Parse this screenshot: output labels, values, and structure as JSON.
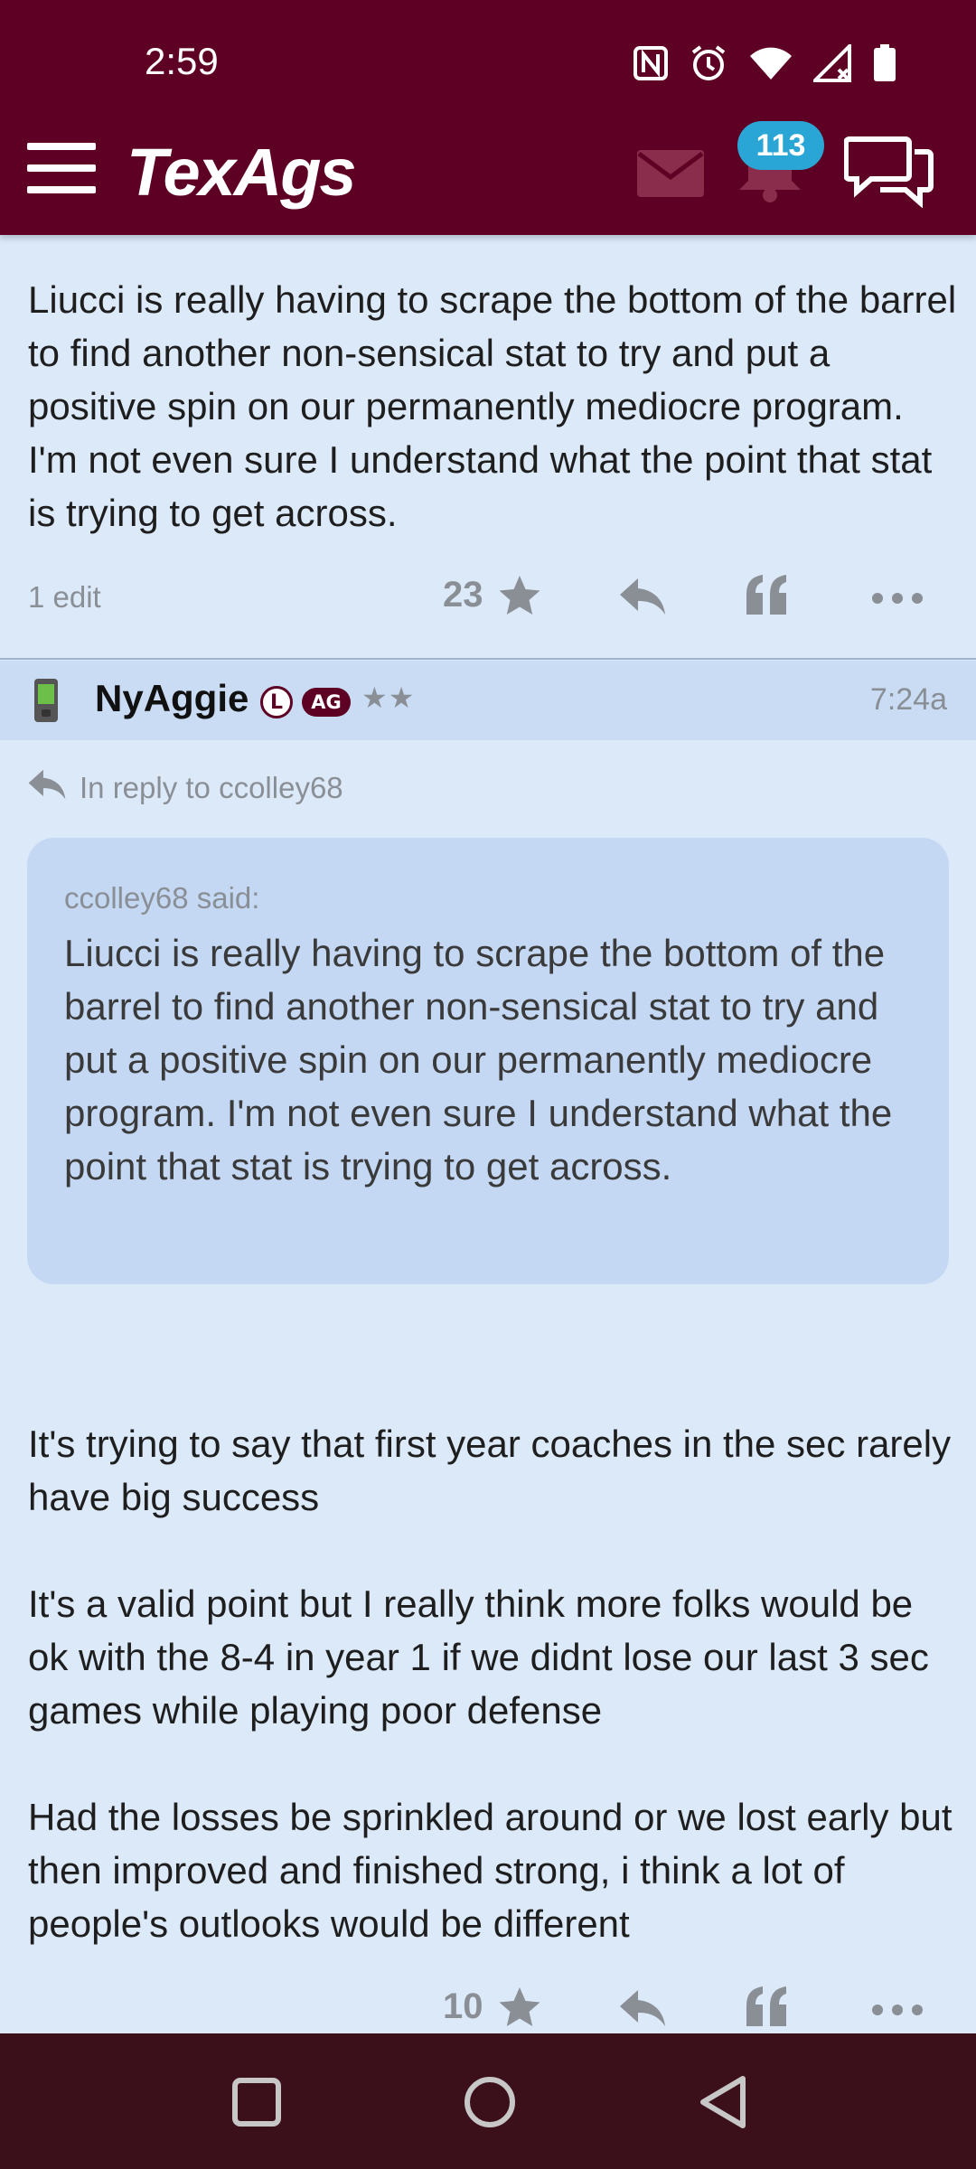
{
  "status_bar": {
    "time": "2:59"
  },
  "header": {
    "logo": "TexAgs",
    "notifications_count": "113"
  },
  "previous_post": {
    "text": "Liucci is really having to scrape the bottom of the barrel to find another non-sensical stat to try and put a positive spin on our permanently mediocre program. I'm not even sure I understand what the point that stat is trying to get across.",
    "edit_label": "1 edit",
    "star_count": "23"
  },
  "post": {
    "username": "NyAggie",
    "badge_l": "L",
    "badge_ag": "AG",
    "rank_stars": "★★",
    "time": "7:24a",
    "reply_to": "In reply to ccolley68",
    "quote_author": "ccolley68 said:",
    "quote_text": "Liucci is really having to scrape the bottom of the barrel to find another non-sensical stat to try and put a positive spin on our permanently mediocre program. I'm not even sure I understand what the point that stat is trying to get across.",
    "paragraphs": [
      "It's trying to say that first year coaches in the sec rarely have big success",
      "It's a valid point but I really think more folks would be ok with the 8-4 in year 1 if we didnt lose our last 3 sec games while playing poor defense",
      "Had the losses be sprinkled around or we lost early but then improved and finished strong, i think a lot of people's outlooks would be different"
    ],
    "star_count": "10"
  },
  "colors": {
    "brand": "#5e0024",
    "background": "#dce9f9",
    "quote_bg": "#c4d8f4",
    "badge": "#2aa6d6"
  }
}
